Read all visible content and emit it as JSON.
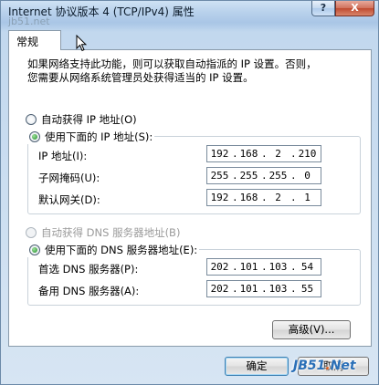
{
  "window": {
    "title": "Internet 协议版本 4 (TCP/IPv4) 属性",
    "help_label": "?",
    "close_label": "X"
  },
  "watermark_top": "jb51.net",
  "tabs": [
    {
      "label": "常规"
    }
  ],
  "description": {
    "line1": "如果网络支持此功能，则可以获取自动指派的 IP 设置。否则，",
    "line2": "您需要从网络系统管理员处获得适当的 IP 设置。"
  },
  "ip_group": {
    "auto_label": "自动获得 IP 地址(O)",
    "auto_selected": false,
    "manual_label": "使用下面的 IP 地址(S):",
    "manual_selected": true,
    "fields": [
      {
        "label": "IP 地址(I):",
        "octets": [
          "192",
          "168",
          "2",
          "210"
        ]
      },
      {
        "label": "子网掩码(U):",
        "octets": [
          "255",
          "255",
          "255",
          "0"
        ]
      },
      {
        "label": "默认网关(D):",
        "octets": [
          "192",
          "168",
          "2",
          "1"
        ]
      }
    ]
  },
  "dns_group": {
    "auto_label": "自动获得 DNS 服务器地址(B)",
    "auto_selected": false,
    "auto_enabled": false,
    "manual_label": "使用下面的 DNS 服务器地址(E):",
    "manual_selected": true,
    "fields": [
      {
        "label": "首选 DNS 服务器(P):",
        "octets": [
          "202",
          "101",
          "103",
          "54"
        ]
      },
      {
        "label": "备用 DNS 服务器(A):",
        "octets": [
          "202",
          "101",
          "103",
          "55"
        ]
      }
    ]
  },
  "buttons": {
    "advanced": "高级(V)...",
    "ok": "确定",
    "cancel": "取消"
  },
  "watermark_bottom": {
    "prefix": "JB51",
    "dot": ".",
    "suffix": "Net"
  },
  "colors": {
    "radio_selected": "#1c8a28",
    "close_button": "#c24b30"
  }
}
